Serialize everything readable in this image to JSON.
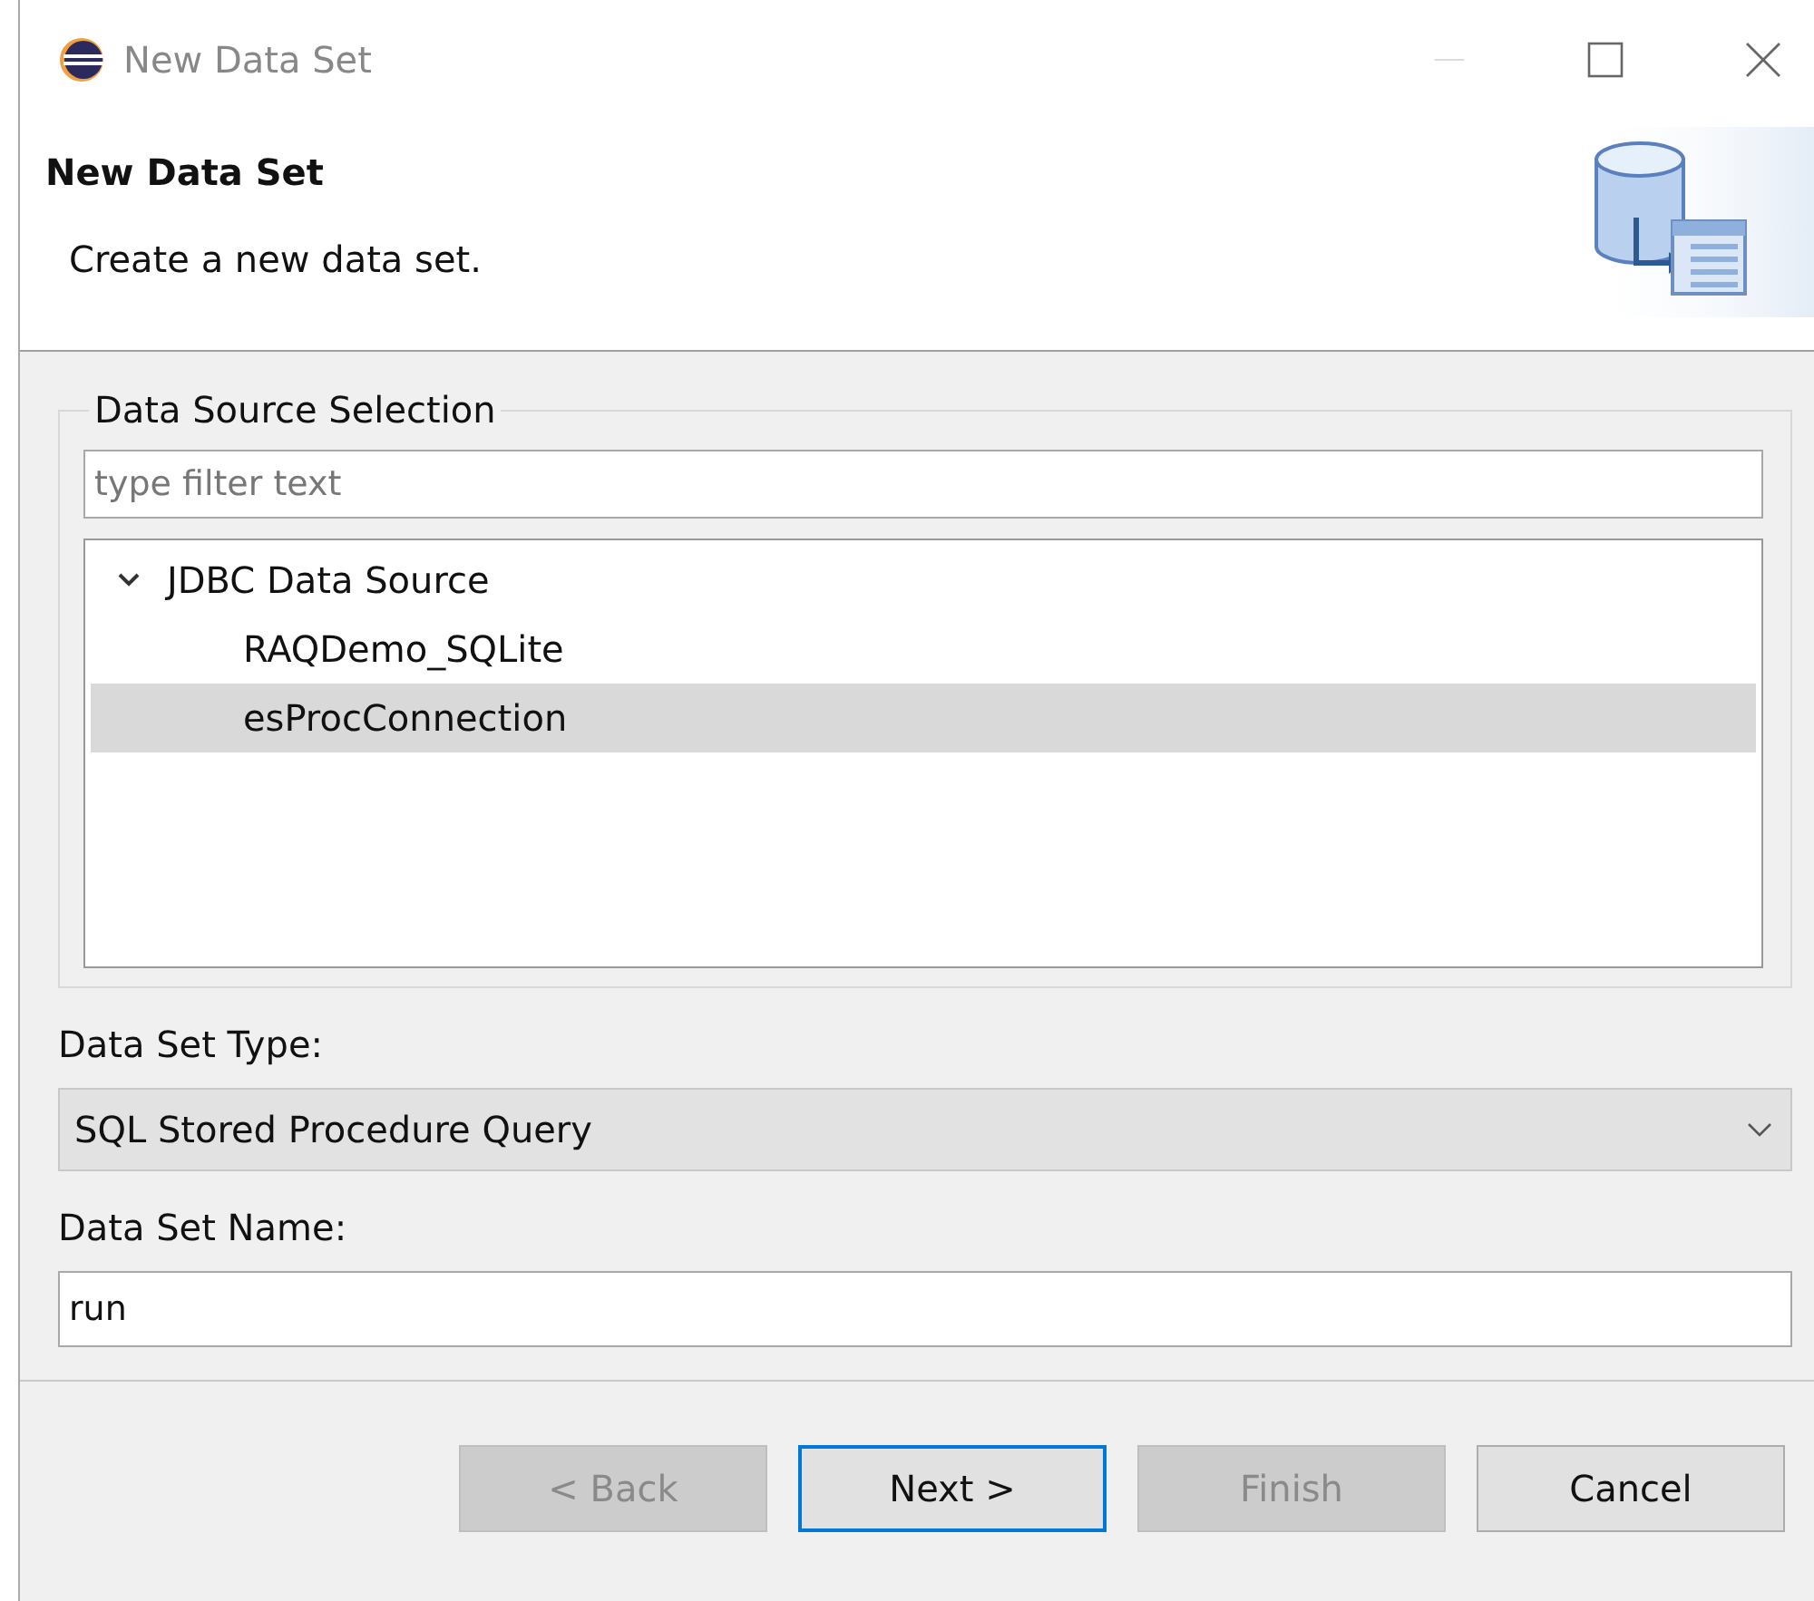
{
  "window": {
    "title": "New Data Set"
  },
  "header": {
    "title": "New Data Set",
    "description": "Create a new data set."
  },
  "data_source_selection": {
    "legend": "Data Source Selection",
    "filter": {
      "placeholder": "type filter text"
    },
    "tree": [
      {
        "label": "JDBC Data Source",
        "expanded": true,
        "selected": false,
        "children": [
          {
            "label": "RAQDemo_SQLite",
            "selected": false
          },
          {
            "label": "esProcConnection",
            "selected": true
          }
        ]
      }
    ]
  },
  "data_set_type": {
    "label": "Data Set Type:",
    "value": "SQL Stored Procedure Query"
  },
  "data_set_name": {
    "label": "Data Set Name:",
    "value": "run"
  },
  "buttons": [
    {
      "label": "< Back",
      "disabled": true,
      "focused": false
    },
    {
      "label": "Next >",
      "disabled": false,
      "focused": true
    },
    {
      "label": "Finish",
      "disabled": true,
      "focused": false
    },
    {
      "label": "Cancel",
      "disabled": false,
      "focused": false
    }
  ]
}
